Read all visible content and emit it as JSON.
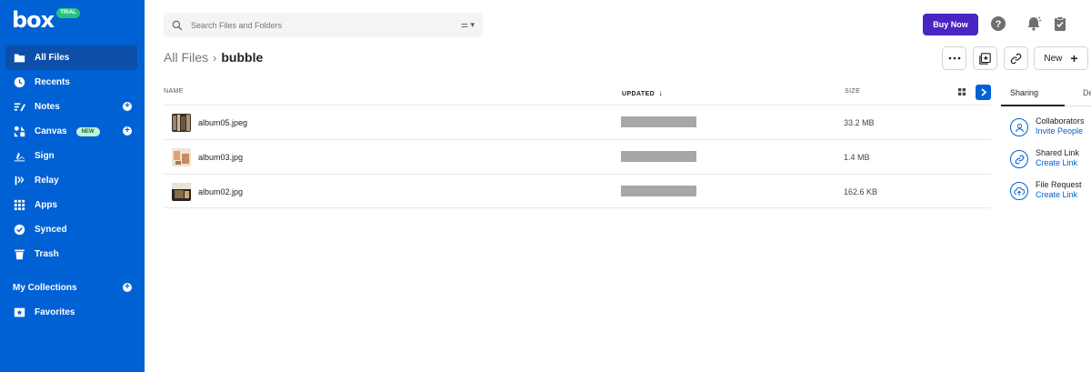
{
  "app": {
    "logo_text": "box",
    "trial_badge": "TRIAL"
  },
  "sidebar": {
    "items": [
      {
        "label": "All Files",
        "icon": "folder-icon"
      },
      {
        "label": "Recents",
        "icon": "clock-icon"
      },
      {
        "label": "Notes",
        "icon": "notes-icon"
      },
      {
        "label": "Canvas",
        "icon": "canvas-icon",
        "badge": "NEW"
      },
      {
        "label": "Sign",
        "icon": "sign-icon"
      },
      {
        "label": "Relay",
        "icon": "relay-icon"
      },
      {
        "label": "Apps",
        "icon": "apps-grid-icon"
      },
      {
        "label": "Synced",
        "icon": "check-circle-icon"
      },
      {
        "label": "Trash",
        "icon": "trash-icon"
      }
    ],
    "collections_label": "My Collections",
    "favorites_label": "Favorites"
  },
  "search": {
    "placeholder": "Search Files and Folders"
  },
  "header": {
    "buy_now": "Buy Now"
  },
  "breadcrumb": {
    "root": "All Files",
    "separator": "›",
    "current": "bubble"
  },
  "toolbar": {
    "new_label": "New",
    "new_plus": "+"
  },
  "table": {
    "columns": {
      "name": "NAME",
      "updated": "UPDATED",
      "updated_sort": "↓",
      "size": "SIZE"
    },
    "rows": [
      {
        "name": "album05.jpeg",
        "size": "33.2 MB"
      },
      {
        "name": "album03.jpg",
        "size": "1.4 MB"
      },
      {
        "name": "album02.jpg",
        "size": "162.6 KB"
      }
    ]
  },
  "right_panel": {
    "tab_sharing": "Sharing",
    "tab_details": "De",
    "items": [
      {
        "title": "Collaborators",
        "link": "Invite People",
        "icon": "user-icon"
      },
      {
        "title": "Shared Link",
        "link": "Create Link",
        "icon": "link-icon"
      },
      {
        "title": "File Request",
        "link": "Create Link",
        "icon": "cloud-upload-icon"
      }
    ]
  },
  "colors": {
    "sidebar": "#0061d5",
    "buy_now": "#4826c2",
    "accent": "#0061d5"
  }
}
